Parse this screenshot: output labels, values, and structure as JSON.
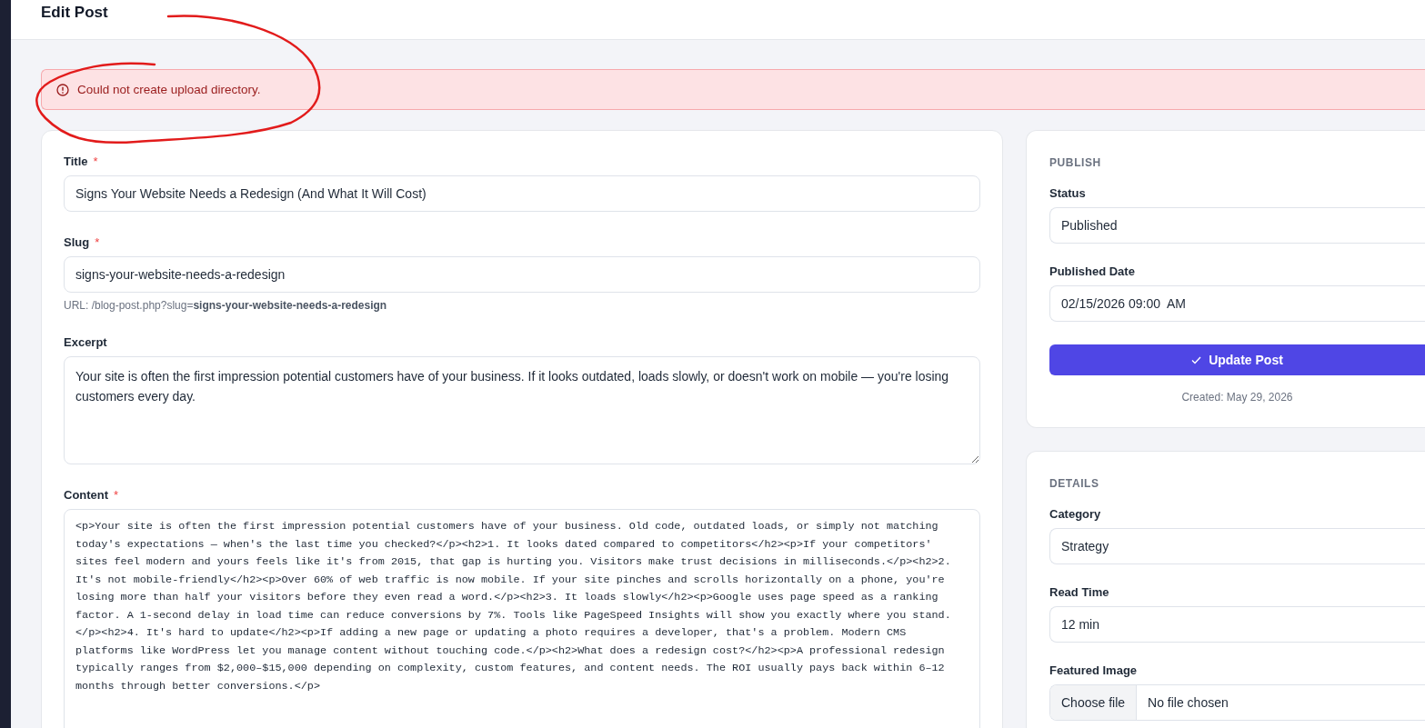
{
  "header": {
    "title": "Edit Post"
  },
  "alert": {
    "kind": "error",
    "message": "Could not create upload directory."
  },
  "main_form": {
    "fields": [
      {
        "kind": "text",
        "label": "Title",
        "required_mark": "*",
        "value": "Signs Your Website Needs a Redesign (And What It Will Cost)"
      },
      {
        "kind": "text",
        "label": "Slug",
        "required_mark": "*",
        "value": "signs-your-website-needs-a-redesign",
        "help": "URL: /blog-post.php?slug=**signs-your-website-needs-a-redesign**"
      },
      {
        "kind": "textarea",
        "label": "Excerpt",
        "value": "Your site is often the first impression potential customers have of your business. If it looks outdated, loads slowly, or doesn't work on mobile — you're losing customers every day."
      },
      {
        "kind": "code",
        "label": "Content",
        "required_mark": "*",
        "value": "<p>Your site is often the first impression potential customers have of your business. Old code, outdated loads, or simply not matching today's expectations — when's the last time you checked?</p><h2>1. It looks dated compared to competitors</h2><p>If your competitors' sites feel modern and yours feels like it's from 2015, that gap is hurting you. Visitors make trust decisions in milliseconds.</p><h2>2. It's not mobile-friendly</h2><p>Over 60% of web traffic is now mobile. If your site pinches and scrolls horizontally on a phone, you're losing more than half your visitors before they even read a word.</p><h2>3. It loads slowly</h2><p>Google uses page speed as a ranking factor. A 1-second delay in load time can reduce conversions by 7%. Tools like PageSpeed Insights will show you exactly where you stand.</p><h2>4. It's hard to update</h2><p>If adding a new page or updating a photo requires a developer, that's a problem. Modern CMS platforms like WordPress let you manage content without touching code.</p><h2>What does a redesign cost?</h2><p>A professional redesign typically ranges from $2,000–$15,000 depending on complexity, custom features, and content needs. The ROI usually pays back within 6–12 months through better conversions.</p>"
      }
    ]
  },
  "publish": {
    "heading": "PUBLISH",
    "fields": [
      {
        "kind": "text",
        "label": "Status",
        "value": "Published"
      },
      {
        "kind": "text",
        "label": "Published Date",
        "value": "02/15/2026 09:00  AM"
      }
    ],
    "button": "Update Post",
    "created": "Created: May 29, 2026"
  },
  "details": {
    "heading": "DETAILS",
    "fields": [
      {
        "kind": "text",
        "label": "Category",
        "value": "Strategy"
      },
      {
        "kind": "text",
        "label": "Read Time",
        "value": "12 min"
      },
      {
        "kind": "file",
        "label": "Featured Image",
        "button": "Choose file",
        "value": "No file chosen"
      }
    ]
  }
}
